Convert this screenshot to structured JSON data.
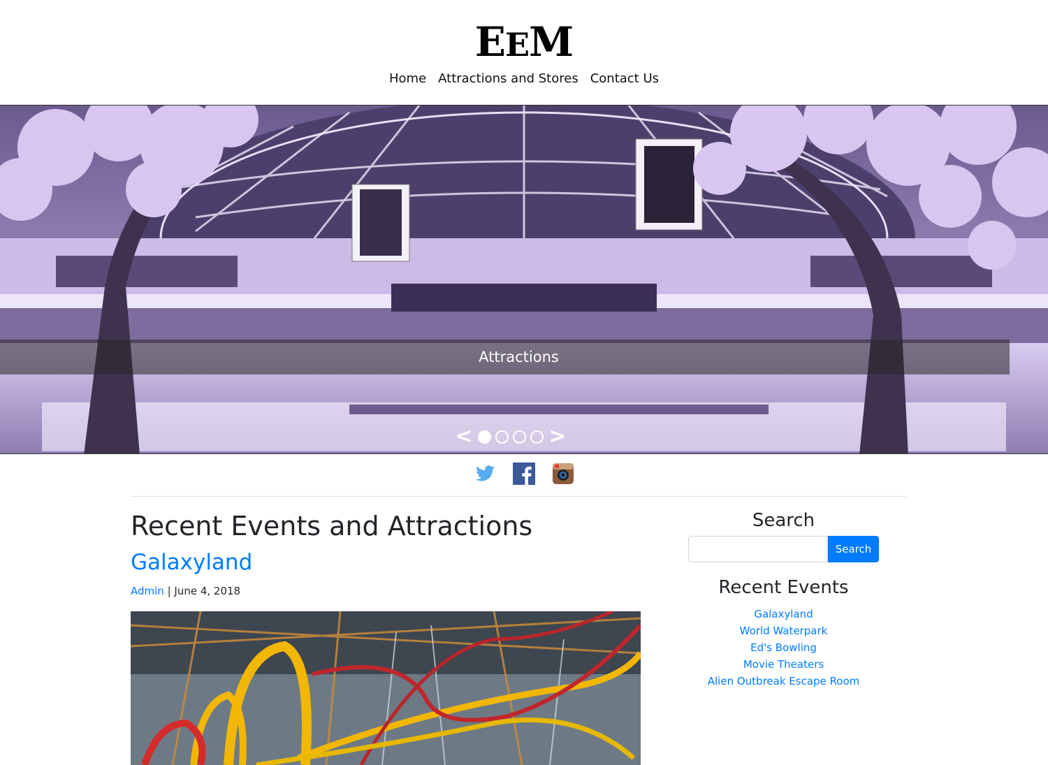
{
  "header": {
    "logo": {
      "part1": "E",
      "part2": "E",
      "part3": "M"
    },
    "nav": [
      "Home",
      "Attractions and Stores",
      "Contact Us"
    ]
  },
  "carousel": {
    "caption": "Attractions",
    "prev_label": "<",
    "next_label": ">",
    "slide_count": 4,
    "active_slide": 1
  },
  "social": [
    "twitter-icon",
    "facebook-icon",
    "instagram-icon"
  ],
  "main": {
    "title": "Recent Events and Attractions",
    "post": {
      "title": "Galaxyland",
      "author": "Admin",
      "separator": " | ",
      "date": "June 4, 2018"
    }
  },
  "sidebar": {
    "search_title": "Search",
    "search_button": "Search",
    "search_value": "",
    "recent_title": "Recent Events",
    "recent_events": [
      "Galaxyland",
      "World Waterpark",
      "Ed's Bowling",
      "Movie Theaters",
      "Alien Outbreak Escape Room"
    ]
  },
  "colors": {
    "link": "#007bff",
    "button": "#007bff",
    "carousel_tint": "#b8a6d6"
  }
}
